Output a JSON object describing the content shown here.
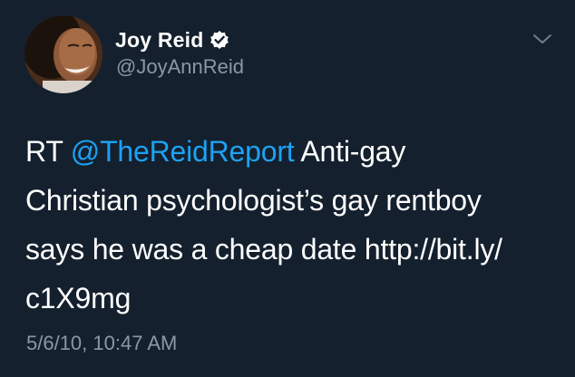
{
  "tweet": {
    "display_name": "Joy Reid",
    "handle": "@JoyAnnReid",
    "verified": true,
    "body": {
      "prefix": "RT ",
      "mention": "@TheReidReport",
      "line1_rest": " Anti-gay",
      "line2": "Christian psychologist’s gay rentboy",
      "line3": "says he was a cheap date http://bit.ly/",
      "line4": "c1X9mg"
    },
    "timestamp": "5/6/10, 10:47 AM"
  },
  "icons": {
    "verified": "verified-badge-icon",
    "menu": "chevron-down-icon"
  },
  "colors": {
    "background": "#14202d",
    "mention": "#1da1f2",
    "secondary_text": "#8899a6",
    "primary_text": "#ffffff"
  }
}
